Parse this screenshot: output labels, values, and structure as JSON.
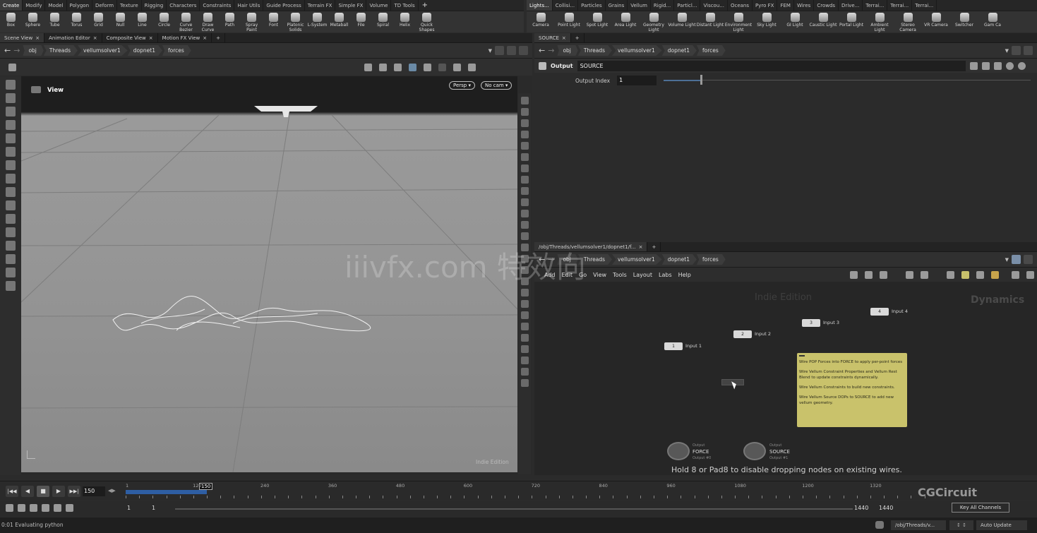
{
  "left_shelf": {
    "tabs": [
      "Create",
      "Modify",
      "Model",
      "Polygon",
      "Deform",
      "Texture",
      "Rigging",
      "Characters",
      "Constraints",
      "Hair Utils",
      "Guide Process",
      "Terrain FX",
      "Simple FX",
      "Volume",
      "TD Tools"
    ],
    "tools": [
      {
        "label": "Box",
        "icon": "box-icon"
      },
      {
        "label": "Sphere",
        "icon": "sphere-icon"
      },
      {
        "label": "Tube",
        "icon": "tube-icon"
      },
      {
        "label": "Torus",
        "icon": "torus-icon"
      },
      {
        "label": "Grid",
        "icon": "grid-icon"
      },
      {
        "label": "Null",
        "icon": "null-icon"
      },
      {
        "label": "Line",
        "icon": "line-icon"
      },
      {
        "label": "Circle",
        "icon": "circle-icon"
      },
      {
        "label": "Curve Bezier",
        "icon": "curve-bezier-icon"
      },
      {
        "label": "Draw Curve",
        "icon": "draw-curve-icon"
      },
      {
        "label": "Path",
        "icon": "path-icon"
      },
      {
        "label": "Spray Paint",
        "icon": "spray-paint-icon"
      },
      {
        "label": "Font",
        "icon": "font-icon"
      },
      {
        "label": "Platonic Solids",
        "icon": "platonic-icon"
      },
      {
        "label": "L-System",
        "icon": "lsystem-icon"
      },
      {
        "label": "Metaball",
        "icon": "metaball-icon"
      },
      {
        "label": "File",
        "icon": "file-icon"
      },
      {
        "label": "Spiral",
        "icon": "spiral-icon"
      },
      {
        "label": "Helix",
        "icon": "helix-icon"
      },
      {
        "label": "Quick Shapes",
        "icon": "quick-shapes-icon"
      }
    ]
  },
  "right_shelf": {
    "tabs": [
      "Lights...",
      "Collisi...",
      "Particles",
      "Grains",
      "Vellum",
      "Rigid...",
      "Particl...",
      "Viscou...",
      "Oceans",
      "Pyro FX",
      "FEM",
      "Wires",
      "Crowds",
      "Drive...",
      "Terrai...",
      "Terrai...",
      "Terrai..."
    ],
    "tools": [
      {
        "label": "Camera"
      },
      {
        "label": "Point Light"
      },
      {
        "label": "Spot Light"
      },
      {
        "label": "Area Light"
      },
      {
        "label": "Geometry Light"
      },
      {
        "label": "Volume Light"
      },
      {
        "label": "Distant Light"
      },
      {
        "label": "Environment Light"
      },
      {
        "label": "Sky Light"
      },
      {
        "label": "GI Light"
      },
      {
        "label": "Caustic Light"
      },
      {
        "label": "Portal Light"
      },
      {
        "label": "Ambient Light"
      },
      {
        "label": "Stereo Camera"
      },
      {
        "label": "VR Camera"
      },
      {
        "label": "Switcher"
      },
      {
        "label": "Gam Ca"
      }
    ]
  },
  "left_pane": {
    "tabs": [
      "Scene View",
      "Animation Editor",
      "Composite View",
      "Motion FX View"
    ],
    "path": [
      "obj",
      "Threads",
      "vellumsolver1",
      "dopnet1",
      "forces"
    ],
    "viewport": {
      "label": "View",
      "persp": "Persp",
      "cam": "No cam",
      "watermark": "Indie Edition"
    }
  },
  "params_pane": {
    "tab": "SOURCE",
    "path": [
      "obj",
      "Threads",
      "vellumsolver1",
      "dopnet1",
      "forces"
    ],
    "node_type": "Output",
    "node_name": "SOURCE",
    "param_label": "Output Index",
    "param_value": "1"
  },
  "network_pane": {
    "tab": "/obj/Threads/vellumsolver1/dopnet1/f...",
    "path": [
      "obj",
      "Threads",
      "vellumsolver1",
      "dopnet1",
      "forces"
    ],
    "menu": [
      "Add",
      "Edit",
      "Go",
      "View",
      "Tools",
      "Layout",
      "Labs",
      "Help"
    ],
    "watermark": "Indie Edition",
    "context": "Dynamics",
    "inputs": [
      {
        "num": "1",
        "label": "Input 1"
      },
      {
        "num": "2",
        "label": "Input 2"
      },
      {
        "num": "3",
        "label": "Input 3"
      },
      {
        "num": "4",
        "label": "Input 4"
      }
    ],
    "sticky_note": [
      "Wire POP Forces into FORCE to apply per-point forces",
      "Wire Vellum Constraint Properties and Vellum Rest Blend to update constraints dynamically.",
      "Wire Vellum Constraints to build new constraints.",
      "Wire Vellum Source DOPs to SOURCE to add new vellum geometry."
    ],
    "outputs": [
      {
        "name": "FORCE",
        "type": "Output",
        "sub": "Output #0"
      },
      {
        "name": "SOURCE",
        "type": "Output",
        "sub": "Output #1"
      }
    ],
    "hint": "Hold 8 or Pad8 to disable dropping nodes on existing wires.",
    "overlay_text": "iiivfx.com 特效向"
  },
  "timeline": {
    "current_frame": "150",
    "frame_marker": "150",
    "start": "1",
    "start2": "1",
    "end": "1440",
    "end2": "1440",
    "ticks": [
      "1",
      "120",
      "240",
      "360",
      "480",
      "600",
      "720",
      "840",
      "960",
      "1080",
      "1200",
      "1320"
    ],
    "progress": 0.1
  },
  "bottom": {
    "status": "0:01 Evaluating python",
    "key_all": "Key All Channels",
    "path_status": "/obj/Threads/v...",
    "auto_update": "Auto Update",
    "logo": "CGCircuit"
  }
}
